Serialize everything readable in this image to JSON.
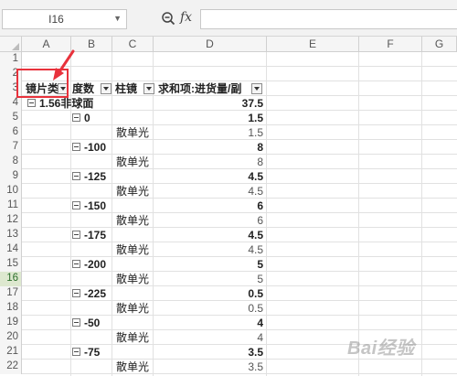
{
  "name_box": {
    "value": "I16"
  },
  "formula_bar": {
    "fx_label": "fx",
    "value": ""
  },
  "columns": [
    "A",
    "B",
    "C",
    "D",
    "E",
    "F",
    "G"
  ],
  "row_numbers": [
    "1",
    "2",
    "3",
    "4",
    "5",
    "6",
    "7",
    "8",
    "9",
    "10",
    "11",
    "12",
    "13",
    "14",
    "15",
    "16",
    "17",
    "18",
    "19",
    "20",
    "21",
    "22"
  ],
  "selected_row": "16",
  "pivot": {
    "headers": {
      "lens_type": "镜片类",
      "degree": "度数",
      "cylinder": "柱镜",
      "sum": "求和项:进货量/副"
    },
    "top_group": {
      "label": "1.56非球面",
      "total": "37.5"
    },
    "groups": [
      {
        "label": "0",
        "subtotal": "1.5",
        "item": "散单光",
        "value": "1.5"
      },
      {
        "label": "-100",
        "subtotal": "8",
        "item": "散单光",
        "value": "8"
      },
      {
        "label": "-125",
        "subtotal": "4.5",
        "item": "散单光",
        "value": "4.5"
      },
      {
        "label": "-150",
        "subtotal": "6",
        "item": "散单光",
        "value": "6"
      },
      {
        "label": "-175",
        "subtotal": "4.5",
        "item": "散单光",
        "value": "4.5"
      },
      {
        "label": "-200",
        "subtotal": "5",
        "item": "散单光",
        "value": "5"
      },
      {
        "label": "-225",
        "subtotal": "0.5",
        "item": "散单光",
        "value": "0.5"
      },
      {
        "label": "-50",
        "subtotal": "4",
        "item": "散单光",
        "value": "4"
      },
      {
        "label": "-75",
        "subtotal": "3.5",
        "item": "散单光",
        "value": "3.5"
      }
    ]
  },
  "watermark": "Bai经验"
}
